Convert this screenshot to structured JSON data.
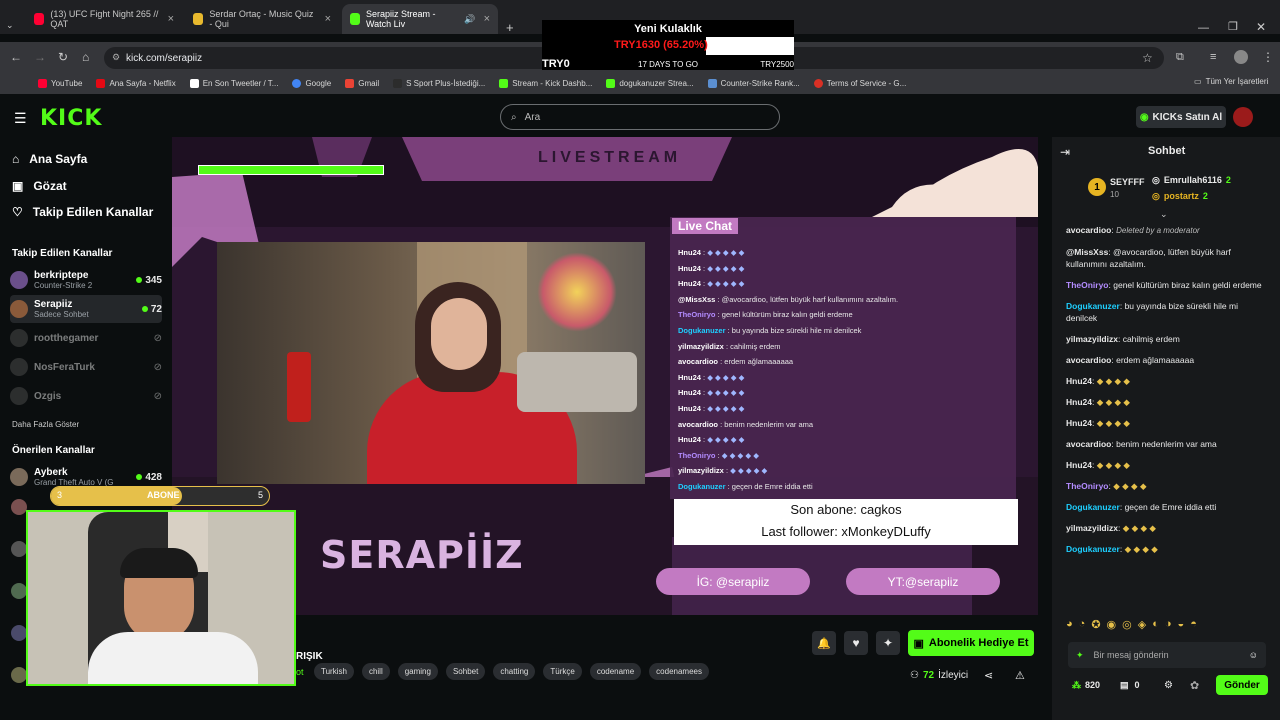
{
  "browser": {
    "tabs": [
      {
        "title": "(13) UFC Fight Night 265 // QAT",
        "color": "#ff0033"
      },
      {
        "title": "Serdar Ortaç - Music Quiz - Qui",
        "color": "#e8b92e"
      },
      {
        "title": "Serapiiz Stream - Watch Liv",
        "color": "#53fc18"
      }
    ],
    "new_tab": "+",
    "url": "kick.com/serapiiz",
    "bookmarks": [
      {
        "label": "YouTube",
        "color": "#ff0033"
      },
      {
        "label": "Ana Sayfa - Netflix",
        "color": "#e50914"
      },
      {
        "label": "En Son Tweetler / T...",
        "color": "#ffffff"
      },
      {
        "label": "Google",
        "color": "#4285f4"
      },
      {
        "label": "Gmail",
        "color": "#ea4335"
      },
      {
        "label": "S Sport Plus-İstediği...",
        "color": "#2c2c2c"
      },
      {
        "label": "Stream - Kick Dashb...",
        "color": "#53fc18"
      },
      {
        "label": "dogukanuzer Strea...",
        "color": "#53fc18"
      },
      {
        "label": "Counter-Strike Rank...",
        "color": "#5b8fd1"
      },
      {
        "label": "Terms of Service - G...",
        "color": "#d93025"
      }
    ],
    "all_bookmarks": "Tüm Yer İşaretleri"
  },
  "ticker": {
    "title": "Yeni Kulaklık",
    "amount": "TRY1630 (65.20%)",
    "start": "TRY0",
    "days": "17 DAYS TO GO",
    "goal": "TRY2500",
    "progress": 65.2
  },
  "header": {
    "search_placeholder": "Ara",
    "buy_kicks": "KICKs Satın Al"
  },
  "sidebar": {
    "nav": [
      "Ana Sayfa",
      "Gözat",
      "Takip Edilen Kanallar"
    ],
    "followed_title": "Takip Edilen Kanallar",
    "followed": [
      {
        "name": "berkriptepe",
        "category": "Counter-Strike 2",
        "viewers": "345",
        "live": true
      },
      {
        "name": "Serapiiz",
        "category": "Sadece Sohbet",
        "viewers": "72",
        "live": true
      },
      {
        "name": "rootthegamer",
        "category": "",
        "viewers": "",
        "live": false
      },
      {
        "name": "NosFeraTurk",
        "category": "",
        "viewers": "",
        "live": false
      },
      {
        "name": "Ozgis",
        "category": "",
        "viewers": "",
        "live": false
      }
    ],
    "show_more": "Daha Fazla Göster",
    "recommended_title": "Önerilen Kanallar",
    "recommended": [
      {
        "name": "Ayberk",
        "category": "Grand Theft Auto V (G",
        "viewers": "428"
      }
    ]
  },
  "stream_overlay": {
    "banner": "LIVESTREAM",
    "live_chat": "Live Chat",
    "brand": "SERAPİİZ",
    "sub_text": "Son abone: cagkos",
    "follower_text": "Last follower: xMonkeyDLuffy",
    "ig": "İG: @serapiiz",
    "yt": "YT:@serapiiz",
    "abone_label": "ABONE",
    "abone_left": "3",
    "abone_right": "5",
    "overlay_chat": [
      {
        "user": "Hnu24",
        "msg": ""
      },
      {
        "user": "Hnu24",
        "msg": ""
      },
      {
        "user": "Hnu24",
        "msg": ""
      },
      {
        "user": "@MissXss",
        "msg": "@avocardioo, lütfen büyük harf kullanımını azaltalım."
      },
      {
        "user": "TheOniryo",
        "msg": "genel kültürüm biraz kalın geldi erdeme"
      },
      {
        "user": "Dogukanuzer",
        "msg": "bu yayında bize sürekli hile mi denilcek"
      },
      {
        "user": "yilmazyildizx",
        "msg": "cahilmiş erdem"
      },
      {
        "user": "avocardioo",
        "msg": "erdem ağlamaaaaaa"
      },
      {
        "user": "Hnu24",
        "msg": ""
      },
      {
        "user": "Hnu24",
        "msg": ""
      },
      {
        "user": "Hnu24",
        "msg": ""
      },
      {
        "user": "avocardioo",
        "msg": "benim nedenlerim var ama"
      },
      {
        "user": "Hnu24",
        "msg": ""
      },
      {
        "user": "TheOniryo",
        "msg": ""
      },
      {
        "user": "yilmazyildizx",
        "msg": ""
      },
      {
        "user": "Dogukanuzer",
        "msg": "geçen de Emre iddia etti"
      }
    ]
  },
  "below_video": {
    "title": "RIŞIK",
    "tags": [
      "Turkish",
      "chill",
      "gaming",
      "Sohbet",
      "chatting",
      "Türkçe",
      "codename",
      "codenamees"
    ],
    "gift_sub": "Abonelik Hediye Et",
    "viewers": "72",
    "viewers_label": "İzleyici"
  },
  "chat": {
    "title": "Sohbet",
    "top_gifter": {
      "name": "SEYFFF",
      "count": "10"
    },
    "leaders": [
      {
        "name": "Emrullah6116",
        "count": "2"
      },
      {
        "name": "postartz",
        "count": "2"
      }
    ],
    "messages": [
      {
        "user": "avocardioo",
        "msg": "Deleted by a moderator",
        "color": "#e8e8e8"
      },
      {
        "user": "@MissXss",
        "msg": "@avocardioo, lütfen büyük harf kullanımını azaltalım.",
        "color": "#e8e8e8"
      },
      {
        "user": "TheOniryo",
        "msg": "genel kültürüm biraz kalın geldi erdeme",
        "color": "#b38cff"
      },
      {
        "user": "Dogukanuzer",
        "msg": "bu yayında bize sürekli hile mi denilcek",
        "color": "#1ecfff"
      },
      {
        "user": "yilmazyildizx",
        "msg": "cahilmiş erdem",
        "color": "#e8e8e8"
      },
      {
        "user": "avocardioo",
        "msg": "erdem ağlamaaaaaa",
        "color": "#e8e8e8"
      },
      {
        "user": "Hnu24",
        "msg": "",
        "color": "#e8e8e8"
      },
      {
        "user": "Hnu24",
        "msg": "",
        "color": "#e8e8e8"
      },
      {
        "user": "Hnu24",
        "msg": "",
        "color": "#e8e8e8"
      },
      {
        "user": "avocardioo",
        "msg": "benim nedenlerim var ama",
        "color": "#e8e8e8"
      },
      {
        "user": "Hnu24",
        "msg": "",
        "color": "#e8e8e8"
      },
      {
        "user": "TheOniryo",
        "msg": "",
        "color": "#b38cff"
      },
      {
        "user": "Dogukanuzer",
        "msg": "geçen de Emre iddia etti",
        "color": "#1ecfff"
      },
      {
        "user": "yilmazyildizx",
        "msg": "",
        "color": "#e8e8e8"
      },
      {
        "user": "Dogukanuzer",
        "msg": "",
        "color": "#1ecfff"
      }
    ],
    "input_placeholder": "Bir mesaj gönderin",
    "points": "820",
    "drops": "0",
    "send": "Gönder"
  },
  "colors": {
    "accent": "#53fc18",
    "bg": "#0b0e0f",
    "chat_bg": "#17191b",
    "pink": "#c06fbf"
  }
}
